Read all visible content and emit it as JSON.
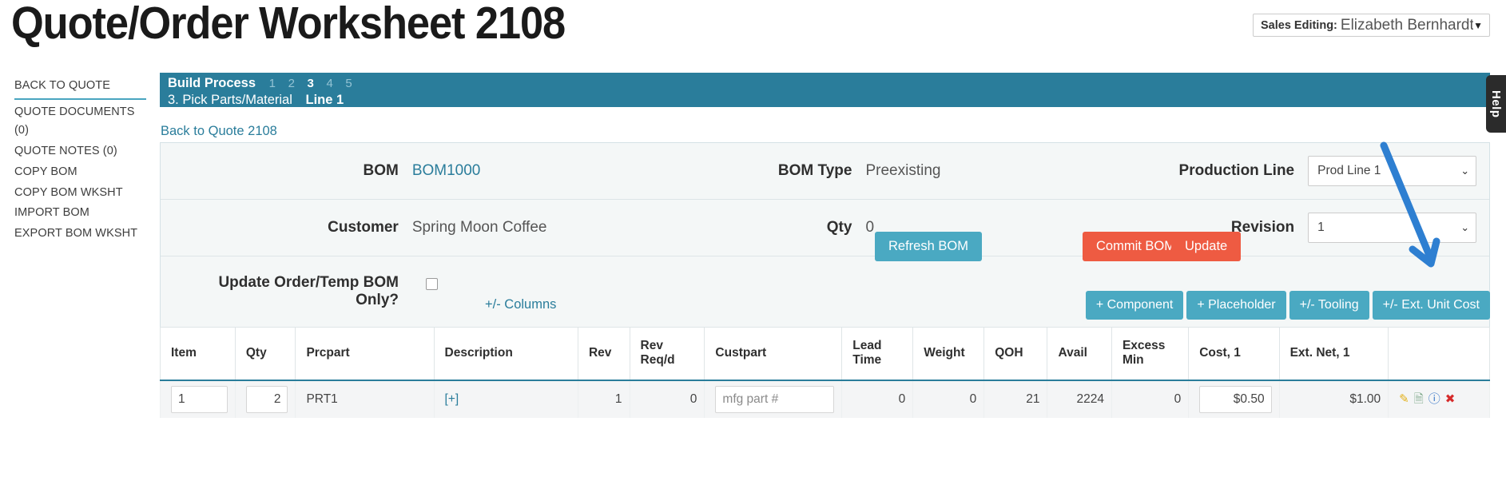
{
  "page_title": "Quote/Order Worksheet 2108",
  "sales_editing": {
    "label": "Sales Editing:",
    "value": "Elizabeth Bernhardt",
    "caret": "▼"
  },
  "sidebar": {
    "items": [
      {
        "label": "BACK TO QUOTE"
      },
      {
        "label": "QUOTE DOCUMENTS (0)"
      },
      {
        "label": "QUOTE NOTES (0)"
      },
      {
        "label": "COPY BOM"
      },
      {
        "label": "COPY BOM WKSHT"
      },
      {
        "label": "IMPORT BOM"
      },
      {
        "label": "EXPORT BOM WKSHT"
      }
    ]
  },
  "build_process": {
    "title": "Build Process",
    "steps": [
      "1",
      "2",
      "3",
      "4",
      "5"
    ],
    "active_step": "3",
    "current_label": "3. Pick Parts/Material",
    "line_label": "Line 1",
    "back_link": "Back to Quote 2108"
  },
  "info": {
    "bom_label": "BOM",
    "bom_value": "BOM1000",
    "bom_type_label": "BOM Type",
    "bom_type_value": "Preexisting",
    "production_line_label": "Production Line",
    "production_line_value": "Prod Line 1",
    "customer_label": "Customer",
    "customer_value": "Spring Moon Coffee",
    "qty_label": "Qty",
    "qty_value": "0",
    "revision_label": "Revision",
    "revision_value": "1",
    "update_only_label_line1": "Update Order/Temp BOM",
    "update_only_label_line2": "Only?",
    "caret": "⌄"
  },
  "buttons": {
    "refresh_bom": "Refresh BOM",
    "commit_bom": "Commit BOM",
    "update": "Update"
  },
  "toolbar": {
    "columns_link": "+/- Columns",
    "add_component": "+ Component",
    "add_placeholder": "+ Placeholder",
    "toggle_tooling": "+/- Tooling",
    "toggle_ext_unit_cost": "+/- Ext. Unit Cost"
  },
  "table": {
    "headers": [
      "Item",
      "Qty",
      "Prcpart",
      "Description",
      "Rev",
      "Rev Req/d",
      "Custpart",
      "Lead Time",
      "Weight",
      "QOH",
      "Avail",
      "Excess Min",
      "Cost, 1",
      "Ext. Net, 1",
      ""
    ],
    "rows": [
      {
        "item": "1",
        "qty": "2",
        "prcpart": "PRT1",
        "description": "[+]",
        "rev": "1",
        "rev_reqd": "0",
        "custpart_placeholder": "mfg part #",
        "lead_time": "0",
        "weight": "0",
        "qoh": "21",
        "avail": "2224",
        "excess_min": "0",
        "cost_1": "$0.50",
        "ext_net_1": "$1.00",
        "actions": [
          "edit-pencil-icon",
          "copy-document-icon",
          "info-circle-icon",
          "delete-x-icon"
        ]
      }
    ]
  },
  "help_tab": {
    "label": "Help"
  },
  "colors": {
    "teal": "#2a7d9b",
    "teal_light": "#4aa9c2",
    "red": "#ee5b42",
    "arrow_blue": "#2e7fd1"
  }
}
